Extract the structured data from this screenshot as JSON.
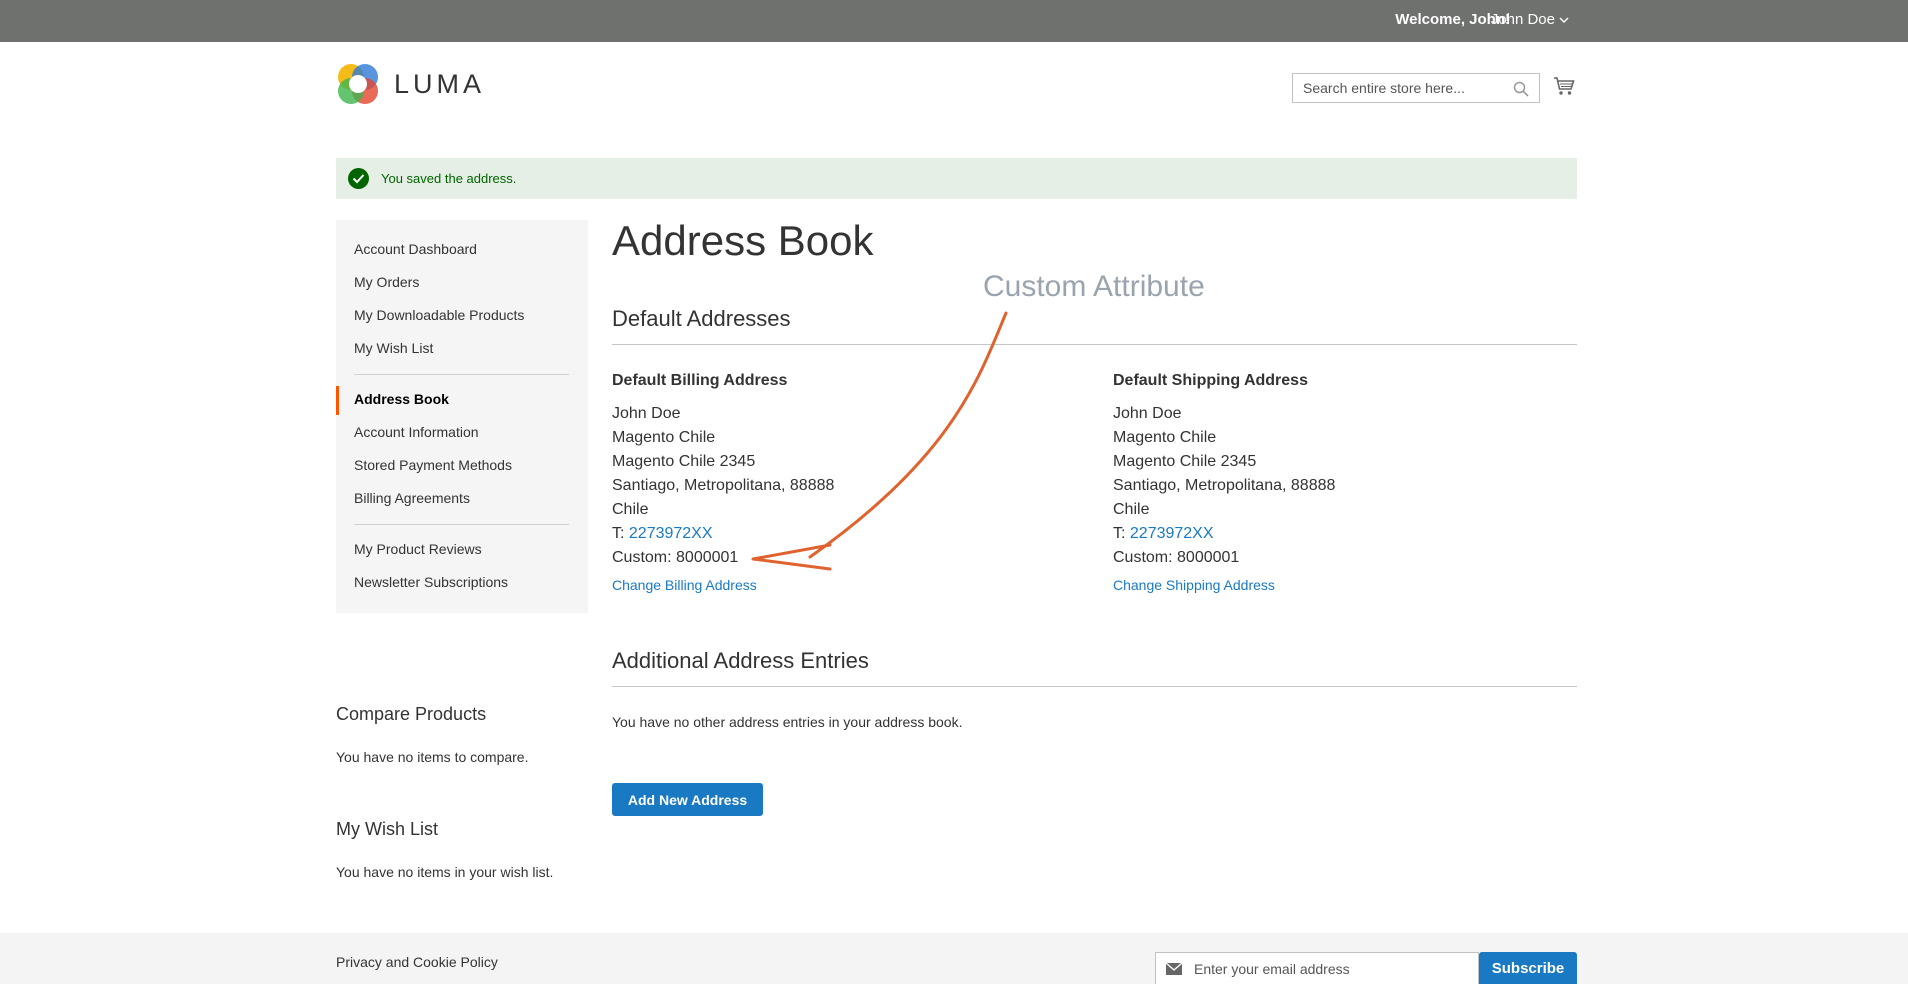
{
  "header": {
    "welcome": "Welcome, John!",
    "user_name": "John Doe",
    "logo_text": "LUMA",
    "search_placeholder": "Search entire store here..."
  },
  "message": {
    "text": "You saved the address."
  },
  "sidebar": {
    "items": [
      {
        "label": "Account Dashboard",
        "current": false
      },
      {
        "label": "My Orders",
        "current": false
      },
      {
        "label": "My Downloadable Products",
        "current": false
      },
      {
        "label": "My Wish List",
        "current": false
      },
      {
        "label": "Address Book",
        "current": true
      },
      {
        "label": "Account Information",
        "current": false
      },
      {
        "label": "Stored Payment Methods",
        "current": false
      },
      {
        "label": "Billing Agreements",
        "current": false
      },
      {
        "label": "My Product Reviews",
        "current": false
      },
      {
        "label": "Newsletter Subscriptions",
        "current": false
      }
    ]
  },
  "main": {
    "title": "Address Book",
    "default_addresses_title": "Default Addresses",
    "annotation": "Custom Attribute",
    "billing": {
      "heading": "Default Billing Address",
      "lines": [
        "John Doe",
        "Magento Chile",
        "Magento Chile 2345",
        "Santiago, Metropolitana, 88888",
        "Chile"
      ],
      "phone_prefix": "T: ",
      "phone": "2273972XX",
      "custom": "Custom: 8000001",
      "change_label": "Change Billing Address"
    },
    "shipping": {
      "heading": "Default Shipping Address",
      "lines": [
        "John Doe",
        "Magento Chile",
        "Magento Chile 2345",
        "Santiago, Metropolitana, 88888",
        "Chile"
      ],
      "phone_prefix": "T: ",
      "phone": "2273972XX",
      "custom": "Custom: 8000001",
      "change_label": "Change Shipping Address"
    },
    "additional_title": "Additional Address Entries",
    "no_entries": "You have no other address entries in your address book.",
    "add_button": "Add New Address"
  },
  "compare": {
    "title": "Compare Products",
    "empty": "You have no items to compare."
  },
  "wishlist": {
    "title": "My Wish List",
    "empty": "You have no items in your wish list."
  },
  "footer": {
    "privacy": "Privacy and Cookie Policy",
    "email_placeholder": "Enter your email address",
    "subscribe": "Subscribe"
  },
  "colors": {
    "accent": "#1979c3",
    "current_marker": "#ff5501",
    "success": "#006400",
    "annotation_arrow": "#e0622f"
  }
}
